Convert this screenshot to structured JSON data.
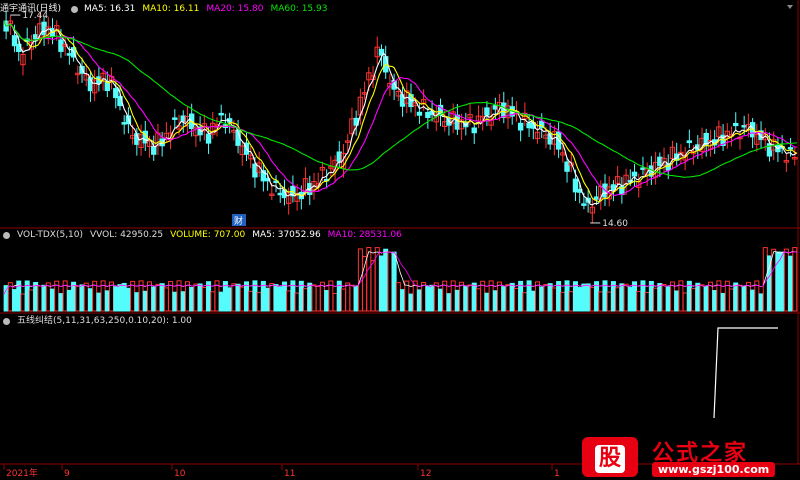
{
  "main_header": {
    "stock_name": "通宇通讯(日线)",
    "ma5": "MA5: 16.31",
    "ma10": "MA10: 16.11",
    "ma20": "MA20: 15.80",
    "ma60": "MA60: 15.93"
  },
  "volume_header": {
    "name": "VOL-TDX(5,10)",
    "vvol": "VVOL: 42950.25",
    "volume": "VOLUME: 707.00",
    "ma5": "MA5: 37052.96",
    "ma10": "MA10: 28531.06"
  },
  "indicator_header": {
    "name": "五线纠结(5,11,31,63,250,0.10,20)",
    "value": ": 1.00"
  },
  "annotations": {
    "high": "17.44",
    "low": "14.60",
    "marker": "财"
  },
  "x_axis": {
    "labels": [
      "2021年",
      "9",
      "10",
      "11",
      "12",
      "1"
    ]
  },
  "watermark": {
    "logo": "股",
    "title": "公式之家",
    "url": "www.gszj100.com"
  },
  "colors": {
    "up": "#ff3232",
    "down": "#54fcfc",
    "ma5": "#ffffff",
    "ma10": "#ffff00",
    "ma20": "#ff00ff",
    "ma60": "#00e600",
    "grid": "#8b0000"
  }
}
